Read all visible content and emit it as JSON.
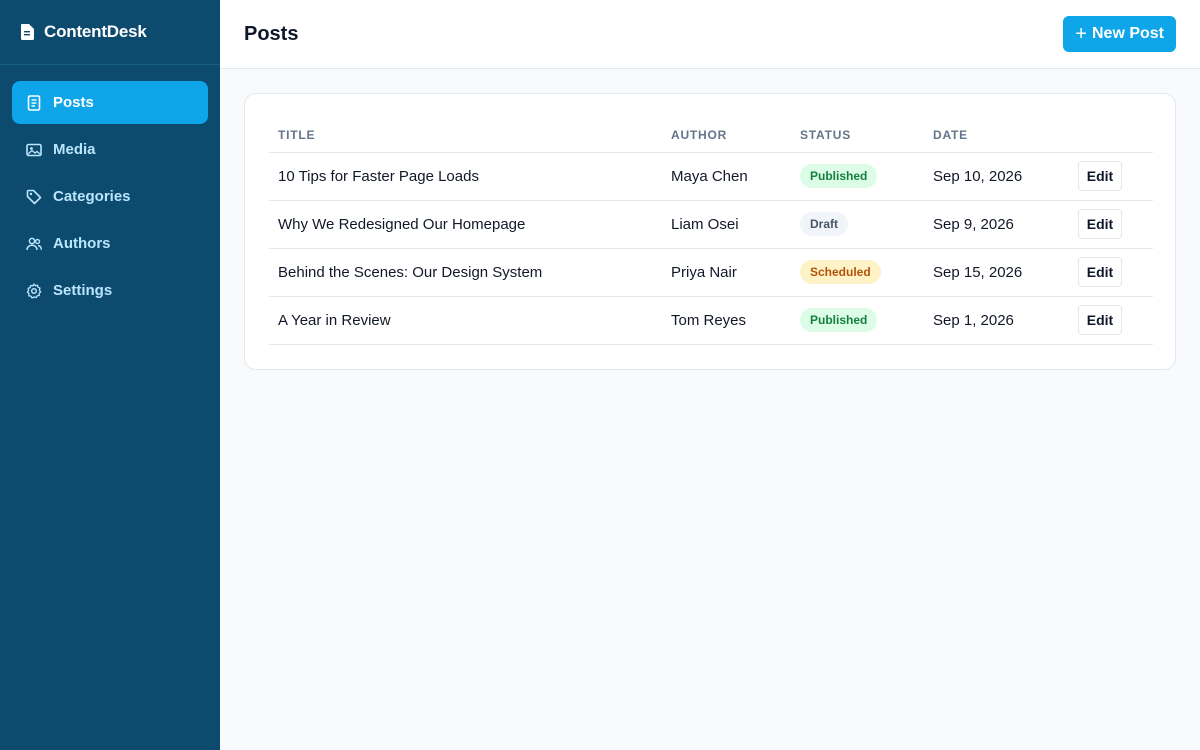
{
  "app": {
    "name": "ContentDesk"
  },
  "sidebar": {
    "items": [
      {
        "label": "Posts",
        "icon": "document-icon",
        "active": true
      },
      {
        "label": "Media",
        "icon": "image-icon",
        "active": false
      },
      {
        "label": "Categories",
        "icon": "tag-icon",
        "active": false
      },
      {
        "label": "Authors",
        "icon": "users-icon",
        "active": false
      },
      {
        "label": "Settings",
        "icon": "gear-icon",
        "active": false
      }
    ]
  },
  "header": {
    "title": "Posts",
    "new_button": "New Post"
  },
  "table": {
    "columns": [
      "TITLE",
      "AUTHOR",
      "STATUS",
      "DATE"
    ],
    "rows": [
      {
        "title": "10 Tips for Faster Page Loads",
        "author": "Maya Chen",
        "status": "Published",
        "date": "Sep 10, 2026",
        "action": "Edit"
      },
      {
        "title": "Why We Redesigned Our Homepage",
        "author": "Liam Osei",
        "status": "Draft",
        "date": "Sep 9, 2026",
        "action": "Edit"
      },
      {
        "title": "Behind the Scenes: Our Design System",
        "author": "Priya Nair",
        "status": "Scheduled",
        "date": "Sep 15, 2026",
        "action": "Edit"
      },
      {
        "title": "A Year in Review",
        "author": "Tom Reyes",
        "status": "Published",
        "date": "Sep 1, 2026",
        "action": "Edit"
      }
    ]
  },
  "colors": {
    "sidebar": "#0c4a6e",
    "accent": "#0ea5e9",
    "published": "#15803d",
    "scheduled": "#b45309",
    "draft": "#475569"
  }
}
